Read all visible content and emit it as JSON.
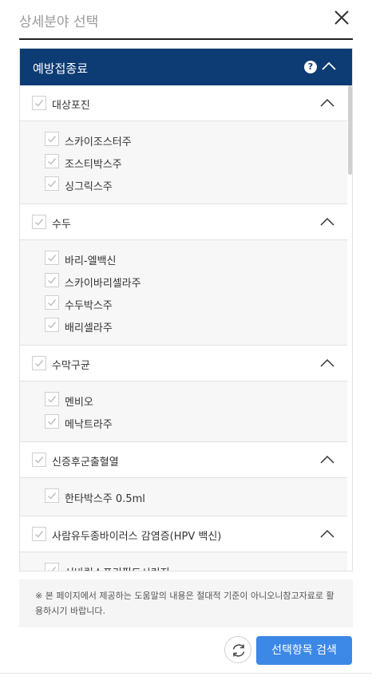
{
  "header": {
    "title": "상세분야 선택",
    "close_icon": "close-icon"
  },
  "category": {
    "label": "예방접종료",
    "help_icon": "help-icon",
    "toggle_icon": "chevron-up-icon"
  },
  "groups": [
    {
      "label": "대상포진",
      "checked": true,
      "expanded": true,
      "items": [
        {
          "label": "스카이조스터주",
          "checked": true
        },
        {
          "label": "조스티박스주",
          "checked": true
        },
        {
          "label": "싱그릭스주",
          "checked": true
        }
      ]
    },
    {
      "label": "수두",
      "checked": true,
      "expanded": true,
      "items": [
        {
          "label": "바리-엘백신",
          "checked": true
        },
        {
          "label": "스카이바리셀라주",
          "checked": true
        },
        {
          "label": "수두박스주",
          "checked": true
        },
        {
          "label": "배리셀라주",
          "checked": true
        }
      ]
    },
    {
      "label": "수막구균",
      "checked": true,
      "expanded": true,
      "items": [
        {
          "label": "멘비오",
          "checked": true
        },
        {
          "label": "메낙트라주",
          "checked": true
        }
      ]
    },
    {
      "label": "신증후군출혈열",
      "checked": true,
      "expanded": true,
      "items": [
        {
          "label": "한타박스주 0.5ml",
          "checked": true
        }
      ]
    },
    {
      "label": "사람유두종바이러스 감염증(HPV 백신)",
      "checked": true,
      "expanded": true,
      "items": [
        {
          "label": "서바릭스프리필드시린지",
          "checked": true
        }
      ]
    }
  ],
  "notice": "※ 본 페이지에서 제공하는 도움말의 내용은 절대적 기준이 아니오니참고자료로 활용하시기 바랍니다.",
  "actions": {
    "refresh_icon": "refresh-icon",
    "search_label": "선택항목 검색",
    "primary_color": "#3c88e6"
  }
}
